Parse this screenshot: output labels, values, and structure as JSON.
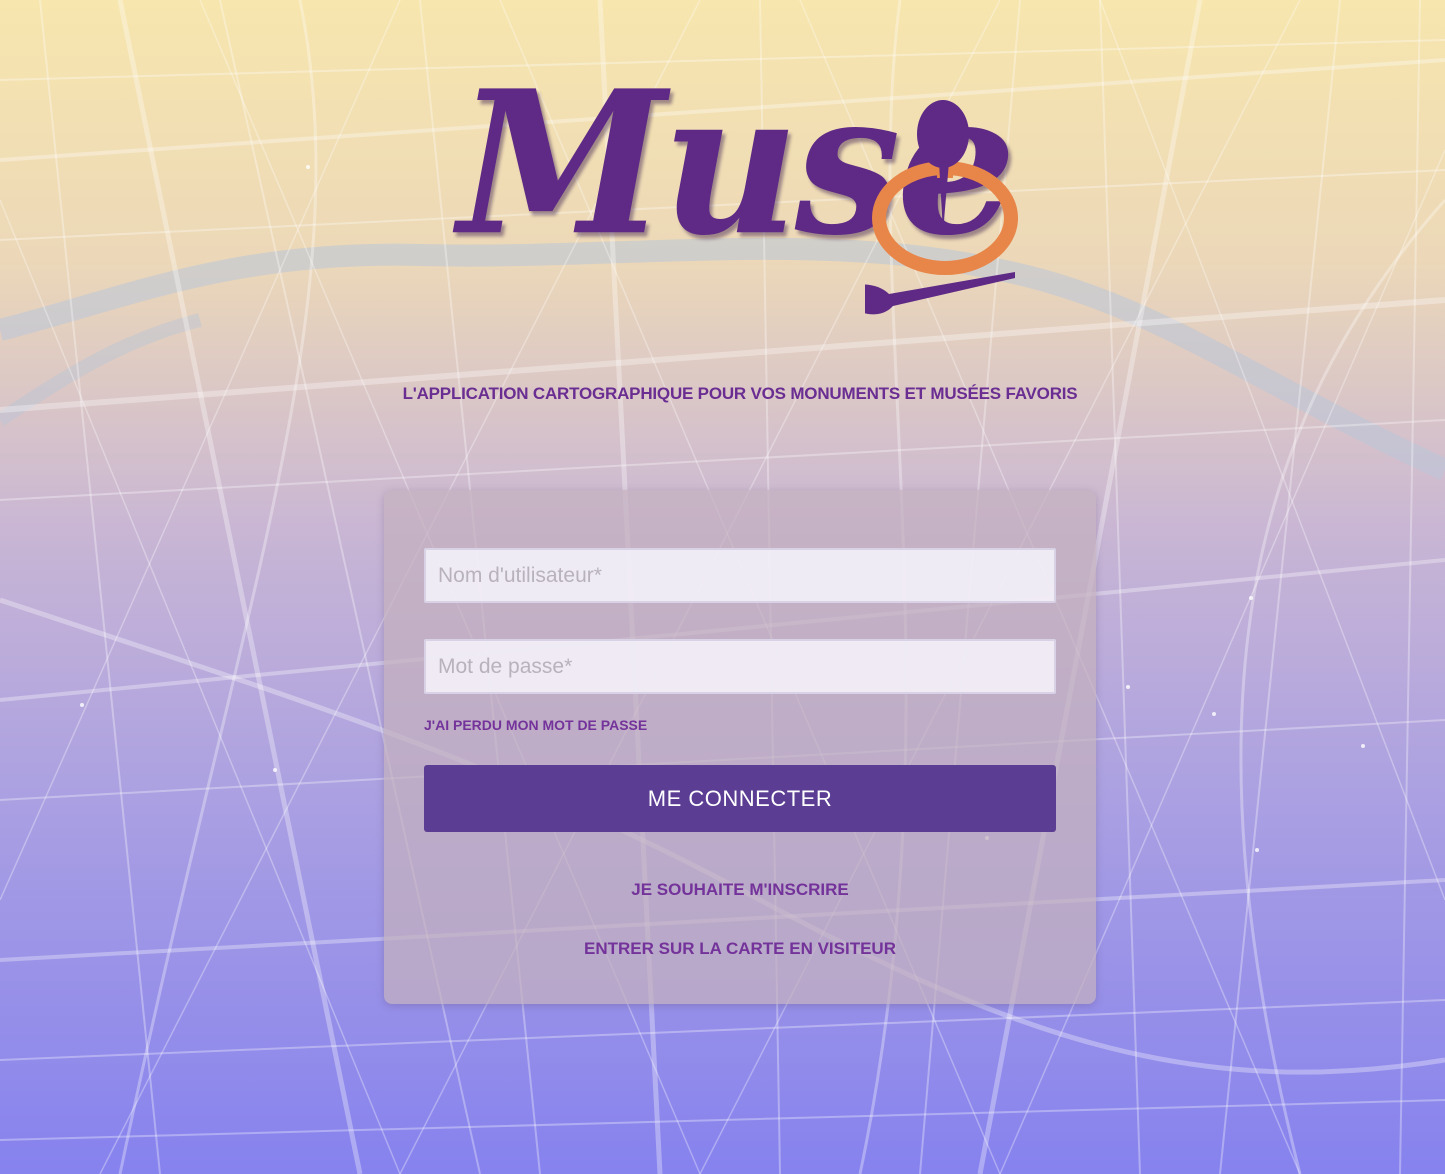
{
  "logo": {
    "wordmark": "Muse",
    "icon": "map-pin-paintbrush-icon"
  },
  "tagline": "L'APPLICATION CARTOGRAPHIQUE POUR VOS MONUMENTS ET MUSÉES FAVORIS",
  "login_form": {
    "username_placeholder": "Nom d'utilisateur*",
    "username_value": "",
    "password_placeholder": "Mot de passe*",
    "password_value": "",
    "forgot_password_label": "J'AI PERDU MON MOT DE PASSE",
    "connect_label": "ME CONNECTER",
    "register_label": "JE SOUHAITE M'INSCRIRE",
    "visitor_label": "ENTRER SUR LA CARTE EN VISITEUR"
  },
  "colors": {
    "brand_purple": "#5e2a86",
    "button_purple": "#5b3d93",
    "link_purple": "#74339a",
    "accent_orange": "#e8864a",
    "gradient_top": "#f7e6ae",
    "gradient_bottom": "#8682ee"
  }
}
